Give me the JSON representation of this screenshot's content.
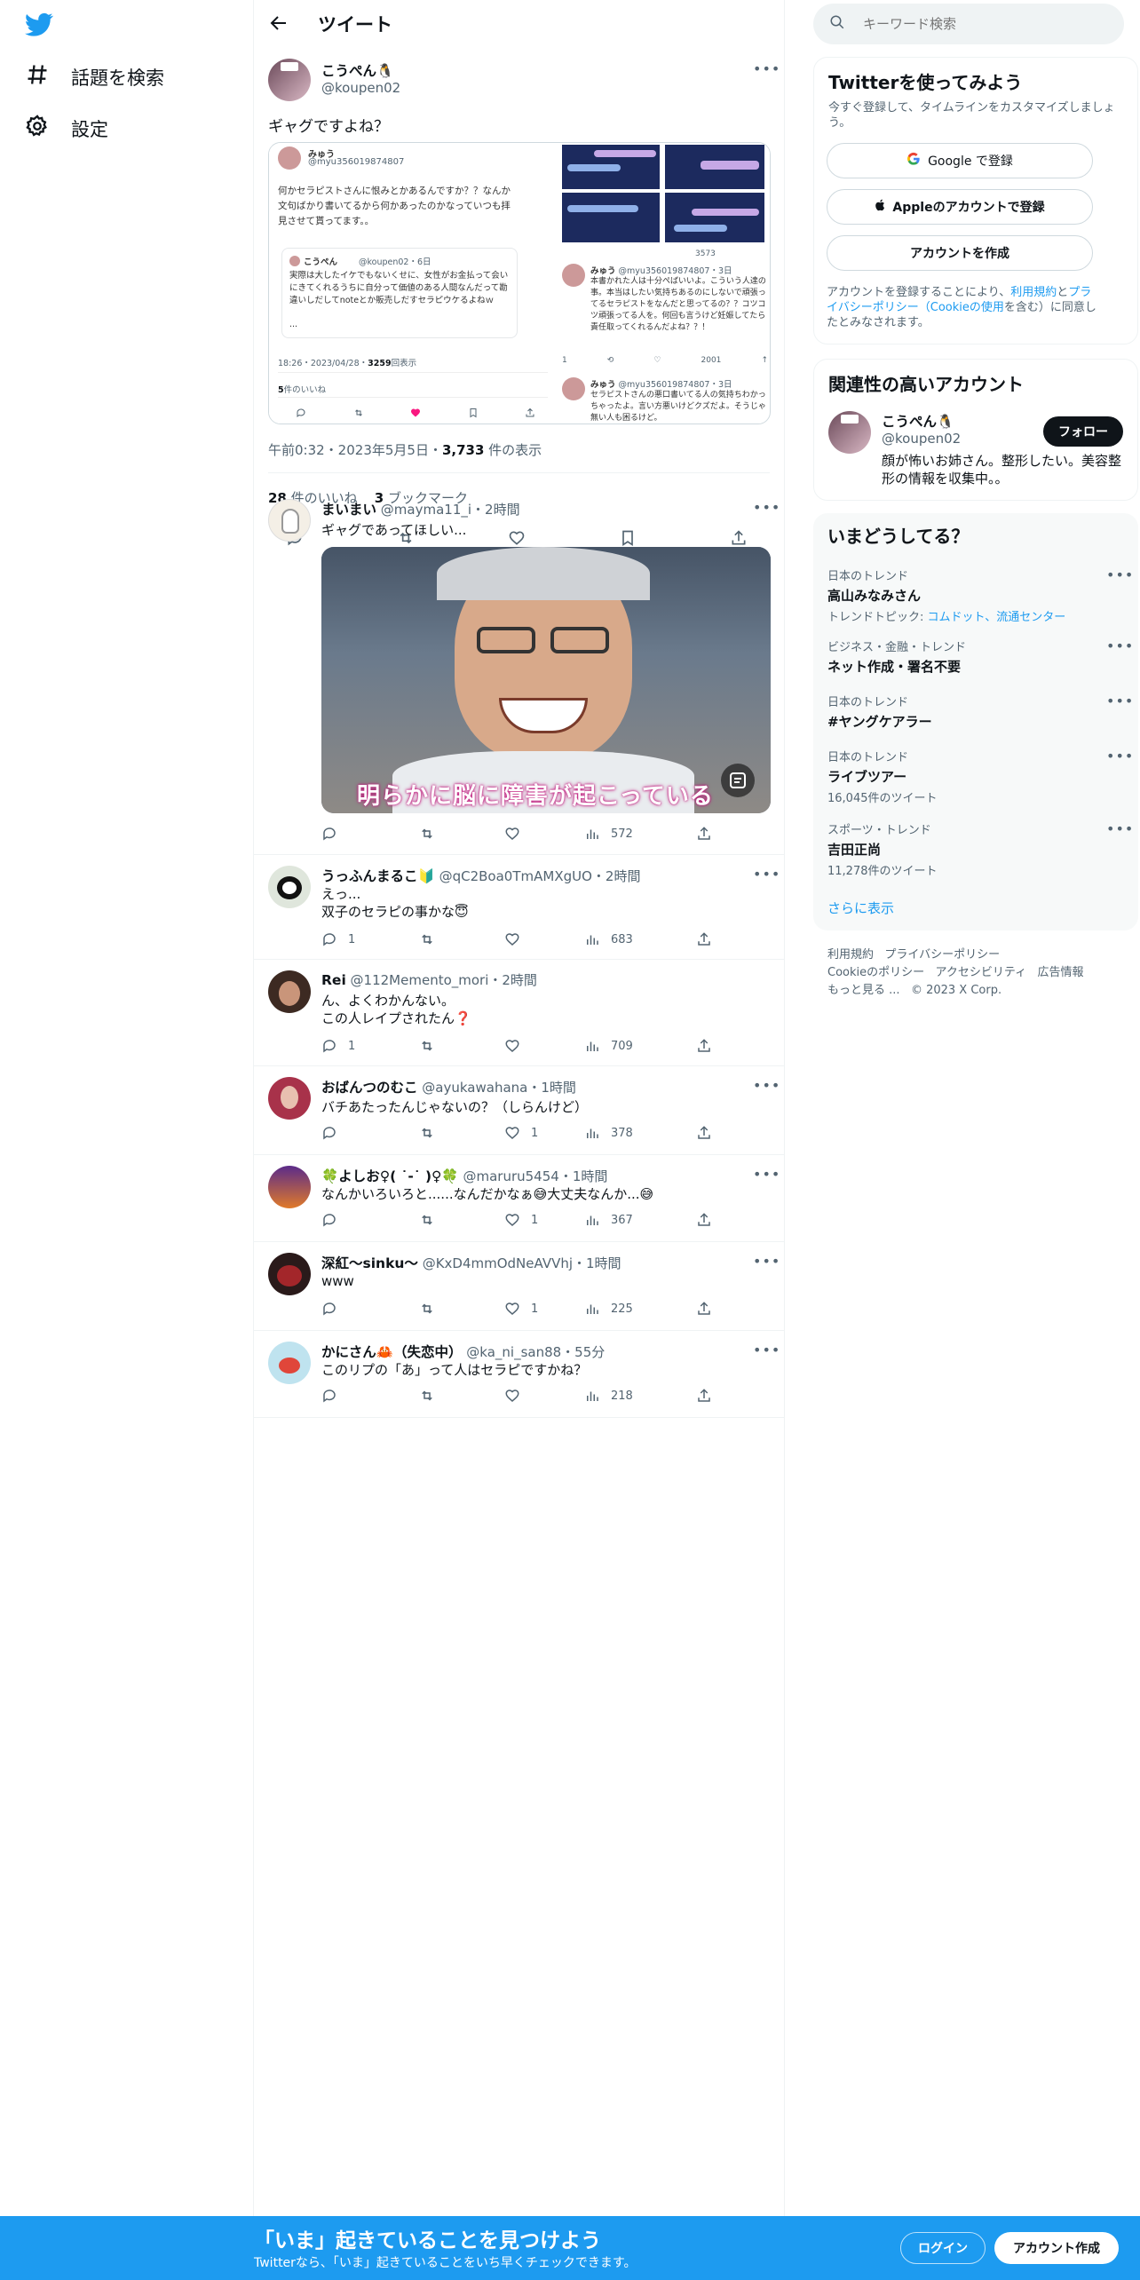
{
  "nav": {
    "explore_label": "話題を検索",
    "settings_label": "設定"
  },
  "header": {
    "title": "ツイート"
  },
  "tweet": {
    "author_name": "こうぺん🐧",
    "author_handle": "@koupen02",
    "text": "ギャグですよね？",
    "timestamp": "午前0:32・2023年5月5日・",
    "views_count": "3,733",
    "views_label": " 件の表示",
    "likes_count": "28",
    "likes_label": " 件のいいね",
    "bookmarks_count": "3",
    "bookmarks_label": " ブックマーク",
    "embedded": {
      "a_name": "みゅう",
      "a_handle": "@myu356019874807",
      "a_text": "何かセラピストさんに恨みとかあるんですか？？なんか文句ばかり書いてるから何かあったのかなっていつも拝見させて貰ってます。。",
      "quote_name": "こうぺん",
      "quote_meta": "@koupen02・6日",
      "quote_text": "実際は大したイケでもないくせに、女性がお金払って会いにきてくれるうちに自分って価値のある人間なんだって勘違いしだしてnoteとか販売しだすセラピウケるよねｗ",
      "quote_more": "...",
      "a_time": "18:26・2023/04/28・",
      "a_views": "3259",
      "a_views_label": "回表示",
      "a_likes": "5",
      "a_likes_label": "件のいいね",
      "b_name": "みゅう",
      "b_meta": "@myu356019874807・3日",
      "b_text": "本書かれた人は十分ぺばいいよ。こういう人達の事。本当はしたい気持ちあるのにしないで頑張ってるセラピストをなんだと思ってるの？？コツコツ頑張ってる人を。何回も言うけど妊娠してたら責任取ってくれるんだよね？？！",
      "b_reply": "1",
      "b_views": "3573",
      "c_views": "2001",
      "d_name": "みゅう",
      "d_meta": "@myu356019874807・3日",
      "d_text": "セラピストさんの悪口書いてる人の気持ちわかっちゃったよ。言い方悪いけどクズだよ。そうじゃ無い人も困るけど。"
    }
  },
  "replies": [
    {
      "name": "まいまい",
      "handle": "@mayma11_i",
      "time": "・2時間",
      "text": "ギャグであってほしい...",
      "image_caption": "明らかに脳に障害が起こっている",
      "reply_count": "",
      "retweet_count": "",
      "like_count": "",
      "views": "572"
    },
    {
      "name": "うっふんまるこ🔰",
      "handle": "@qC2Boa0TmAMXgUO",
      "time": "・2時間",
      "text1": "えっ...",
      "text2": "双子のセラピの事かな😇",
      "reply_count": "1",
      "retweet_count": "",
      "like_count": "",
      "views": "683"
    },
    {
      "name": "Rei",
      "handle": "@112Memento_mori",
      "time": "・2時間",
      "text1": "ん、よくわかんない。",
      "text2": "この人レイプされたん❓",
      "reply_count": "1",
      "retweet_count": "",
      "like_count": "",
      "views": "709"
    },
    {
      "name": "おばんつのむこ",
      "handle": "@ayukawahana",
      "time": "・1時間",
      "text1": "バチあたったんじゃないの？（しらんけど）",
      "reply_count": "",
      "retweet_count": "",
      "like_count": "1",
      "views": "378"
    },
    {
      "name": "🍀よしお♀( ˙-˙ )♀🍀",
      "handle": "@maruru5454",
      "time": "・1時間",
      "text1": "なんかいろいろと......なんだかなぁ😅大丈夫なんか...😅",
      "reply_count": "",
      "retweet_count": "",
      "like_count": "1",
      "views": "367"
    },
    {
      "name": "深紅〜sinku〜",
      "handle": "@KxD4mmOdNeAVVhj",
      "time": "・1時間",
      "text1": "www",
      "reply_count": "",
      "retweet_count": "",
      "like_count": "1",
      "views": "225"
    },
    {
      "name": "かにさん🦀（失恋中）",
      "handle": "@ka_ni_san88",
      "time": "・55分",
      "text1": "このリプの「あ」って人はセラピですかね？",
      "reply_count": "",
      "retweet_count": "",
      "like_count": "",
      "views": "218"
    }
  ],
  "sidebar": {
    "search_placeholder": "キーワード検索",
    "signup": {
      "title": "Twitterを使ってみよう",
      "subtitle": "今すぐ登録して、タイムラインをカスタマイズしましょう。",
      "google_label": "Google で登録",
      "apple_label": "Appleのアカウントで登録",
      "create_label": "アカウントを作成",
      "legal_pre": "アカウントを登録することにより、",
      "legal_terms": "利用規約",
      "legal_and": "と",
      "legal_privacy": "プライバシーポリシー（Cookieの使用",
      "legal_post": "を含む）に同意したとみなされます。"
    },
    "related": {
      "title": "関連性の高いアカウント",
      "name": "こうぺん🐧",
      "handle": "@koupen02",
      "bio": "顔が怖いお姉さん。整形したい。美容整形の情報を収集中。。",
      "follow_label": "フォロー"
    },
    "trends": {
      "title": "いまどうしてる？",
      "items": [
        {
          "category": "日本のトレンド",
          "title": "高山みなみさん",
          "sub_pre": "トレンドトピック: ",
          "sub_links": "コムドット、流通センター"
        },
        {
          "category": "ビジネス・金融・トレンド",
          "title": "ネット作成・署名不要",
          "sub_pre": "",
          "sub_links": ""
        },
        {
          "category": "日本のトレンド",
          "title": "#ヤングケアラー",
          "sub_pre": "",
          "sub_links": ""
        },
        {
          "category": "日本のトレンド",
          "title": "ライブツアー",
          "sub_pre": "16,045件のツイート",
          "sub_links": ""
        },
        {
          "category": "スポーツ・トレンド",
          "title": "吉田正尚",
          "sub_pre": "11,278件のツイート",
          "sub_links": ""
        }
      ],
      "show_more": "さらに表示"
    },
    "footer": {
      "l1a": "利用規約",
      "l1b": "プライバシーポリシー",
      "l2a": "Cookieのポリシー",
      "l2b": "アクセシビリティ",
      "l2c": "広告情報",
      "l3a": "もっと見る ...",
      "l3b": "© 2023 X Corp."
    }
  },
  "bottom": {
    "title": "「いま」起きていることを見つけよう",
    "subtitle": "Twitterなら、「いま」起きていることをいち早くチェックできます。",
    "login_label": "ログイン",
    "signup_label": "アカウント作成"
  },
  "colors": {
    "brand": "#1d9bf0",
    "like": "#f91880"
  }
}
